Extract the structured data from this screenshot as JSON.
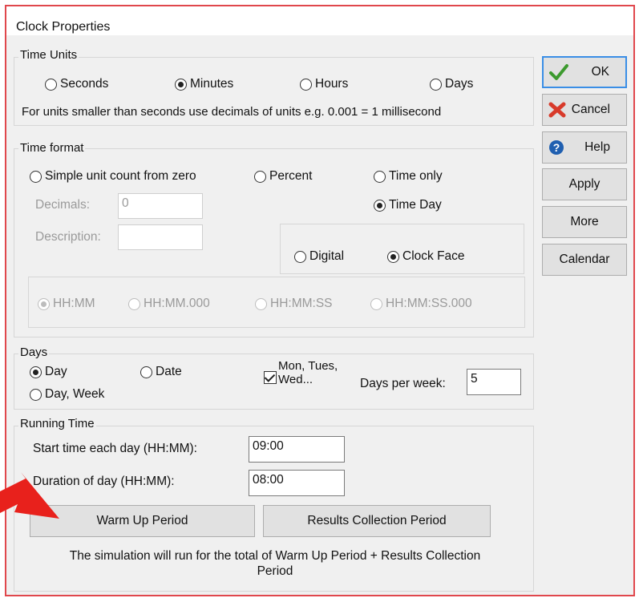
{
  "window": {
    "title": "Clock Properties"
  },
  "time_units": {
    "legend": "Time Units",
    "options": [
      {
        "label": "Seconds",
        "selected": false
      },
      {
        "label": "Minutes",
        "selected": true
      },
      {
        "label": "Hours",
        "selected": false
      },
      {
        "label": "Days",
        "selected": false
      }
    ],
    "note": "For units smaller than seconds use decimals of units e.g. 0.001 = 1 millisecond"
  },
  "time_format": {
    "legend": "Time format",
    "simple_unit": "Simple unit count from zero",
    "percent": "Percent",
    "time_only": "Time only",
    "time_day": "Time  Day",
    "decimals_label": "Decimals:",
    "decimals_value": "0",
    "description_label": "Description:",
    "description_value": "",
    "digital": "Digital",
    "clock_face": "Clock Face",
    "formats": [
      "HH:MM",
      "HH:MM.000",
      "HH:MM:SS",
      "HH:MM:SS.000"
    ]
  },
  "days": {
    "legend": "Days",
    "day": "Day",
    "date": "Date",
    "day_week": "Day, Week",
    "mon_tues": "Mon, Tues, Wed...",
    "days_per_week_label": "Days per week:",
    "days_per_week_value": "5"
  },
  "running_time": {
    "legend": "Running Time",
    "start_label": "Start time each day (HH:MM):",
    "start_value": "09:00",
    "duration_label": "Duration of day (HH:MM):",
    "duration_value": "08:00",
    "warm_up": "Warm Up Period",
    "results": "Results Collection Period",
    "note": "The simulation will run for the total of Warm Up Period + Results Collection Period"
  },
  "buttons": {
    "ok": "OK",
    "cancel": "Cancel",
    "help": "Help",
    "apply": "Apply",
    "more": "More",
    "calendar": "Calendar"
  },
  "colors": {
    "frame": "#e0474c",
    "arrow": "#e8211c",
    "ok_check": "#3c9a2e",
    "cancel_x": "#d83a2a",
    "help_blue": "#1f5fb0"
  }
}
